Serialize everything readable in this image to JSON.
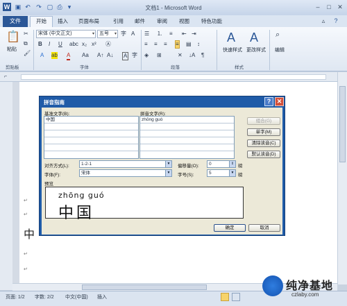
{
  "window": {
    "title": "文档1 - Microsoft Word"
  },
  "tabs": {
    "file": "文件",
    "items": [
      "开始",
      "插入",
      "页面布局",
      "引用",
      "邮件",
      "审阅",
      "视图",
      "特色功能"
    ]
  },
  "ribbon": {
    "paste_label": "粘贴",
    "font_name": "宋体 (中文正文)",
    "font_size": "五号",
    "style_quick": "快速样式",
    "style_change": "更改样式",
    "edit_label": "编辑",
    "group_clipboard": "剪贴板",
    "group_font": "字体",
    "group_paragraph": "段落",
    "group_style": "样式"
  },
  "document": {
    "big_text": "中"
  },
  "dialog": {
    "title": "拼音指南",
    "base_label": "基准文字(B):",
    "ruby_label": "拼音文字(R):",
    "rows": [
      {
        "base": "中国",
        "ruby": "zhōng guó"
      },
      {
        "base": "",
        "ruby": ""
      },
      {
        "base": "",
        "ruby": ""
      },
      {
        "base": "",
        "ruby": ""
      },
      {
        "base": "",
        "ruby": ""
      },
      {
        "base": "",
        "ruby": ""
      }
    ],
    "btn_combine": "组合(G)",
    "btn_single": "单字(M)",
    "btn_clear": "清除读音(C)",
    "btn_default": "默认读音(D)",
    "align_label": "对齐方式(L):",
    "align_value": "1-2-1",
    "offset_label": "偏移量(O):",
    "offset_value": "0",
    "offset_unit": "磅",
    "font_label": "字体(F):",
    "font_value": "宋体",
    "size_label": "字号(S):",
    "size_value": "5",
    "size_unit": "磅",
    "preview_label": "预览",
    "preview_pinyin": "zhōng guó",
    "preview_hanzi": "中国",
    "ok": "确定",
    "cancel": "取消"
  },
  "status": {
    "page": "页面: 1/2",
    "words": "字数: 2/2",
    "lang": "中文(中国)",
    "mode": "插入"
  },
  "watermark": {
    "line1": "纯净基地",
    "line2": "czlaby.com"
  }
}
